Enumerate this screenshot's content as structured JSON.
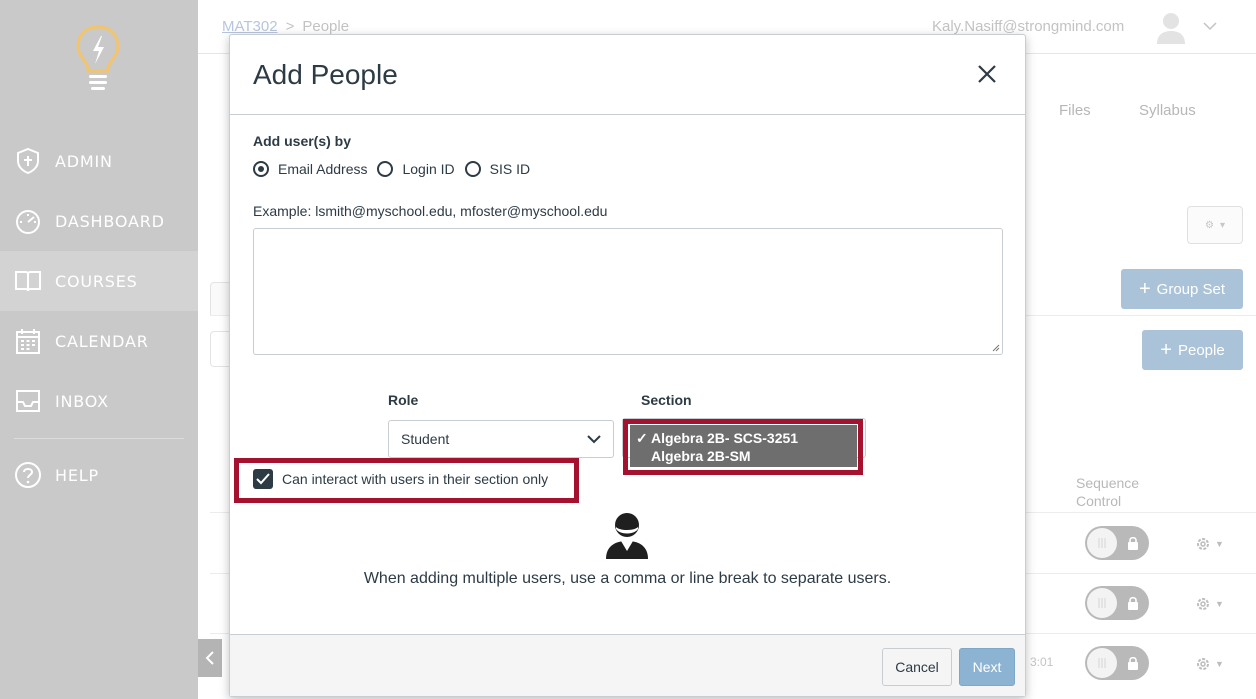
{
  "sidebar": {
    "items": [
      {
        "label": "ADMIN",
        "icon": "shield-icon"
      },
      {
        "label": "DASHBOARD",
        "icon": "speedometer-icon"
      },
      {
        "label": "COURSES",
        "icon": "book-icon"
      },
      {
        "label": "CALENDAR",
        "icon": "calendar-icon"
      },
      {
        "label": "INBOX",
        "icon": "inbox-icon"
      },
      {
        "label": "HELP",
        "icon": "help-icon"
      }
    ],
    "active": "COURSES"
  },
  "topbar": {
    "breadcrumb_course": "MAT302",
    "breadcrumb_separator": ">",
    "breadcrumb_page": "People",
    "user_email": "Kaly.Nasiff@strongmind.com"
  },
  "background": {
    "tabs": [
      "Files",
      "Syllabus"
    ],
    "group_set_button": "Group Set",
    "people_button": "People",
    "column_sequence": "Sequence\nControl",
    "row_time": "3:01"
  },
  "modal": {
    "title": "Add People",
    "add_by_label": "Add user(s) by",
    "radio_options": [
      "Email Address",
      "Login ID",
      "SIS ID"
    ],
    "radio_selected": "Email Address",
    "example_text": "Example: lsmith@myschool.edu, mfoster@myschool.edu",
    "textarea_value": "",
    "role_label": "Role",
    "role_value": "Student",
    "section_label": "Section",
    "section_options": [
      "Algebra 2B- SCS-3251",
      "Algebra 2B-SM"
    ],
    "section_selected": "Algebra 2B- SCS-3251",
    "checkbox_label": "Can interact with users in their section only",
    "checkbox_checked": true,
    "hint_text": "When adding multiple users, use a comma or line break to separate users.",
    "cancel_label": "Cancel",
    "next_label": "Next"
  },
  "colors": {
    "highlight": "#a5122f",
    "sidebar_bg": "#c9c9c9",
    "primary_disabled": "#8db3d2",
    "text": "#2d3b45"
  }
}
